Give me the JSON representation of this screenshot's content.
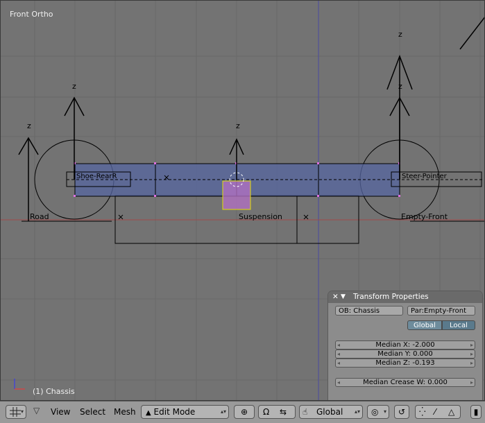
{
  "viewport": {
    "view_name": "Front Ortho",
    "status": "(1) Chassis",
    "axis_label": "z",
    "objects": {
      "road": "Road",
      "suspension": "Suspension",
      "empty_front": "Empty-Front",
      "left_label": "Shoe-RearR",
      "right_label": "Steer-Pointer"
    }
  },
  "transform_panel": {
    "title": "Transform Properties",
    "object_field": "OB: Chassis",
    "parent_field": "Par:Empty-Front",
    "global_label": "Global",
    "local_label": "Local",
    "median_x": "Median X: -2.000",
    "median_y": "Median Y: 0.000",
    "median_z": "Median Z: -0.193",
    "median_crease": "Median Crease W: 0.000"
  },
  "header": {
    "menus": [
      "View",
      "Select",
      "Mesh"
    ],
    "mode": "Edit Mode",
    "orientation": "Global"
  },
  "colors": {
    "viewport_bg": "#737373",
    "selection": "#4a5a8c",
    "vertex_select": "#b070c0",
    "panel_bg": "#8c8c8c",
    "active_toggle": "#5a7a8c"
  }
}
